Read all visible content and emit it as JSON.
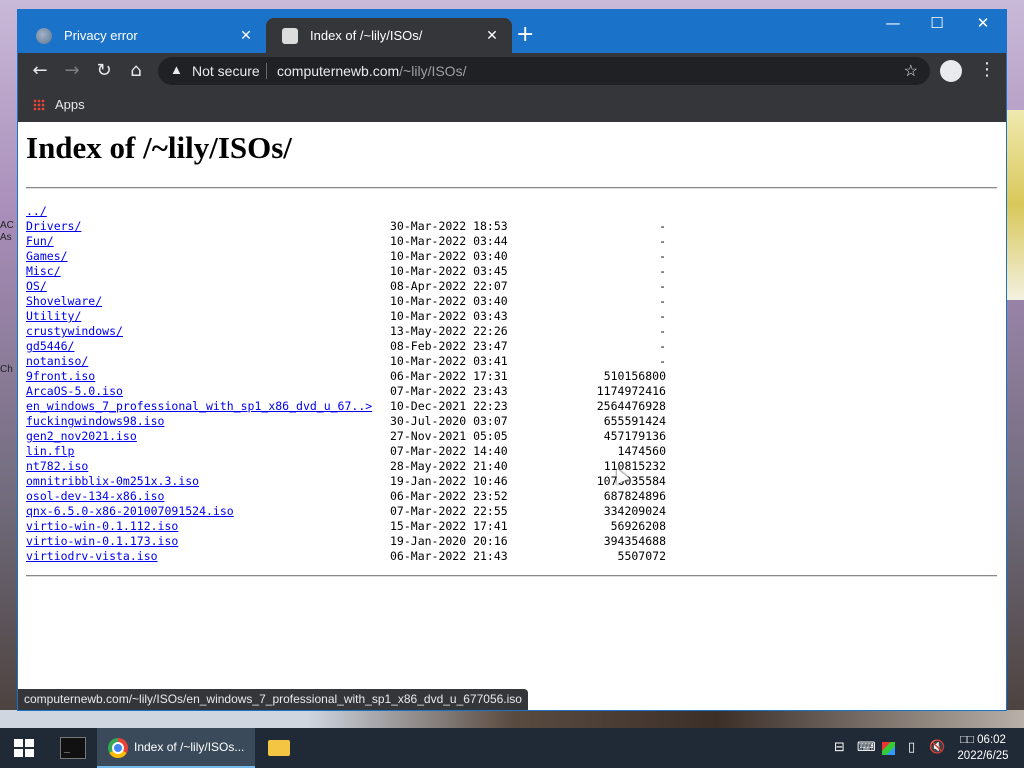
{
  "browser": {
    "tabs": [
      {
        "title": "Privacy error",
        "active": false
      },
      {
        "title": "Index of /~lily/ISOs/",
        "active": true
      }
    ],
    "new_tab_label": "+",
    "window_controls": {
      "minimize": "—",
      "maximize": "☐",
      "close": "✕"
    },
    "security_label": "Not secure",
    "url_host": "computernewb.com",
    "url_path": "/~lily/ISOs/",
    "bookmarks": [
      {
        "label": "Apps"
      }
    ],
    "status_url": "computernewb.com/~lily/ISOs/en_windows_7_professional_with_sp1_x86_dvd_u_677056.iso"
  },
  "page": {
    "title": "Index of /~lily/ISOs/",
    "entries": [
      {
        "name": "../",
        "date": "",
        "size": ""
      },
      {
        "name": "Drivers/",
        "date": "30-Mar-2022 18:53",
        "size": "-"
      },
      {
        "name": "Fun/",
        "date": "10-Mar-2022 03:44",
        "size": "-"
      },
      {
        "name": "Games/",
        "date": "10-Mar-2022 03:40",
        "size": "-"
      },
      {
        "name": "Misc/",
        "date": "10-Mar-2022 03:45",
        "size": "-"
      },
      {
        "name": "OS/",
        "date": "08-Apr-2022 22:07",
        "size": "-"
      },
      {
        "name": "Shovelware/",
        "date": "10-Mar-2022 03:40",
        "size": "-"
      },
      {
        "name": "Utility/",
        "date": "10-Mar-2022 03:43",
        "size": "-"
      },
      {
        "name": "crustywindows/",
        "date": "13-May-2022 22:26",
        "size": "-"
      },
      {
        "name": "gd5446/",
        "date": "08-Feb-2022 23:47",
        "size": "-"
      },
      {
        "name": "notaniso/",
        "date": "10-Mar-2022 03:41",
        "size": "-"
      },
      {
        "name": "9front.iso",
        "date": "06-Mar-2022 17:31",
        "size": "510156800"
      },
      {
        "name": "ArcaOS-5.0.iso",
        "date": "07-Mar-2022 23:43",
        "size": "1174972416"
      },
      {
        "name": "en_windows_7_professional_with_sp1_x86_dvd_u_67..>",
        "date": "10-Dec-2021 22:23",
        "size": "2564476928"
      },
      {
        "name": "fuckingwindows98.iso",
        "date": "30-Jul-2020 03:07",
        "size": "655591424"
      },
      {
        "name": "gen2_nov2021.iso",
        "date": "27-Nov-2021 05:05",
        "size": "457179136"
      },
      {
        "name": "lin.flp",
        "date": "07-Mar-2022 14:40",
        "size": "1474560"
      },
      {
        "name": "nt782.iso",
        "date": "28-May-2022 21:40",
        "size": "110815232"
      },
      {
        "name": "omnitribblix-0m251x.3.iso",
        "date": "19-Jan-2022 10:46",
        "size": "1076035584"
      },
      {
        "name": "osol-dev-134-x86.iso",
        "date": "06-Mar-2022 23:52",
        "size": "687824896"
      },
      {
        "name": "qnx-6.5.0-x86-201007091524.iso",
        "date": "07-Mar-2022 22:55",
        "size": "334209024"
      },
      {
        "name": "virtio-win-0.1.112.iso",
        "date": "15-Mar-2022 17:41",
        "size": "56926208"
      },
      {
        "name": "virtio-win-0.1.173.iso",
        "date": "19-Jan-2020 20:16",
        "size": "394354688"
      },
      {
        "name": "virtiodrv-vista.iso",
        "date": "06-Mar-2022 21:43",
        "size": "5507072"
      }
    ]
  },
  "taskbar": {
    "chrome_label": "Index of /~lily/ISOs...",
    "clock_time": "□□ 06:02",
    "clock_date": "2022/6/25"
  },
  "desktop": {
    "left_edge_text": [
      "AC",
      "As",
      "",
      "",
      "",
      "",
      "",
      "",
      "",
      "",
      "",
      "",
      "Ch"
    ]
  }
}
